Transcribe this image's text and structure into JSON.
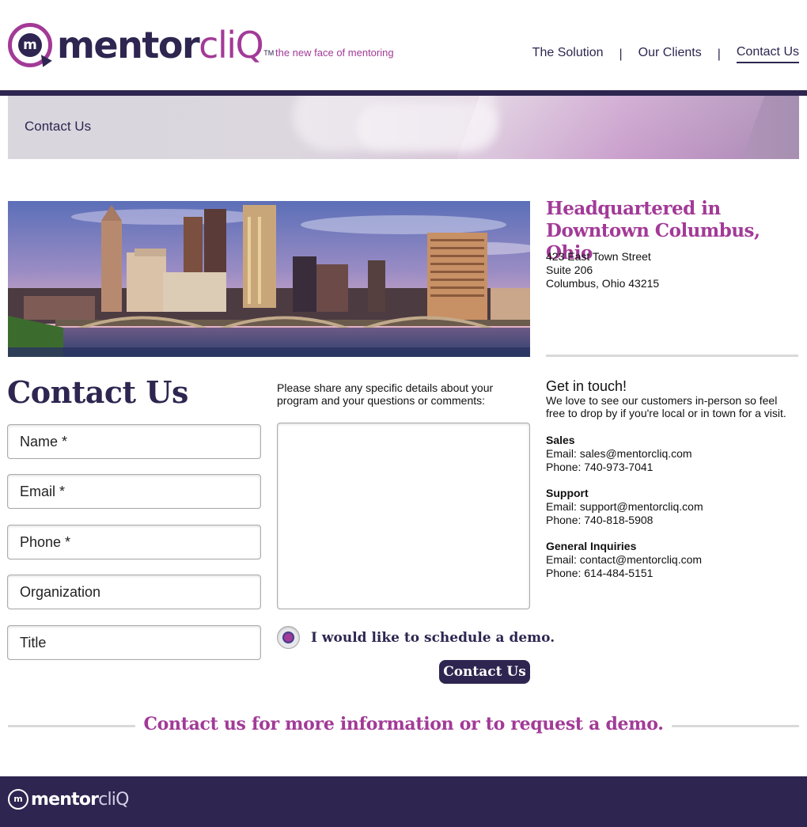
{
  "brand": {
    "logo_mark": "m",
    "logo_word_main": "mentor",
    "logo_word_accent": "cliQ",
    "logo_tm": "TM",
    "tagline": "the new face of mentoring"
  },
  "nav": {
    "items": [
      {
        "label": "The Solution",
        "active": false
      },
      {
        "label": "Our Clients",
        "active": false
      },
      {
        "label": "Contact Us",
        "active": true
      }
    ],
    "separator": "|"
  },
  "banner": {
    "title": "Contact Us"
  },
  "headquarters": {
    "title_line1": "Headquartered in",
    "title_line2": "Downtown Columbus, Ohio",
    "address": [
      "423 East Town Street",
      "Suite 206",
      "Columbus, Ohio 43215"
    ]
  },
  "form": {
    "title": "Contact Us",
    "fields": [
      {
        "placeholder": "Name *"
      },
      {
        "placeholder": "Email *"
      },
      {
        "placeholder": "Phone *"
      },
      {
        "placeholder": "Organization"
      },
      {
        "placeholder": "Title"
      }
    ],
    "details_label": "Please share any specific details about your program and your questions or comments:",
    "comments_value": "",
    "demo_label": "I would like to schedule a demo.",
    "submit_label": "Contact Us"
  },
  "get_in_touch": {
    "title": "Get in touch!",
    "text": "We love to see our customers in-person so feel free to drop by if you're local or in town for a visit.",
    "contacts": [
      {
        "heading": "Sales",
        "email": "Email: sales@mentorcliq.com",
        "phone": "Phone: 740-973-7041"
      },
      {
        "heading": "Support",
        "email": "Email: support@mentorcliq.com",
        "phone": "Phone: 740-818-5908"
      },
      {
        "heading": "General Inquiries",
        "email": "Email: contact@mentorcliq.com",
        "phone": "Phone: 614-484-5151"
      }
    ]
  },
  "cta": {
    "text": "Contact us for more information or to request a demo."
  },
  "footer": {
    "logo_mark": "m",
    "logo_word_main": "mentor",
    "logo_word_accent": "cliQ"
  },
  "colors": {
    "brand_dark": "#2e2650",
    "brand_accent": "#a23a97"
  },
  "icons": {
    "logo": "mentorcliq-logo",
    "skyline": "columbus-skyline-image",
    "radio": "radio-button"
  }
}
